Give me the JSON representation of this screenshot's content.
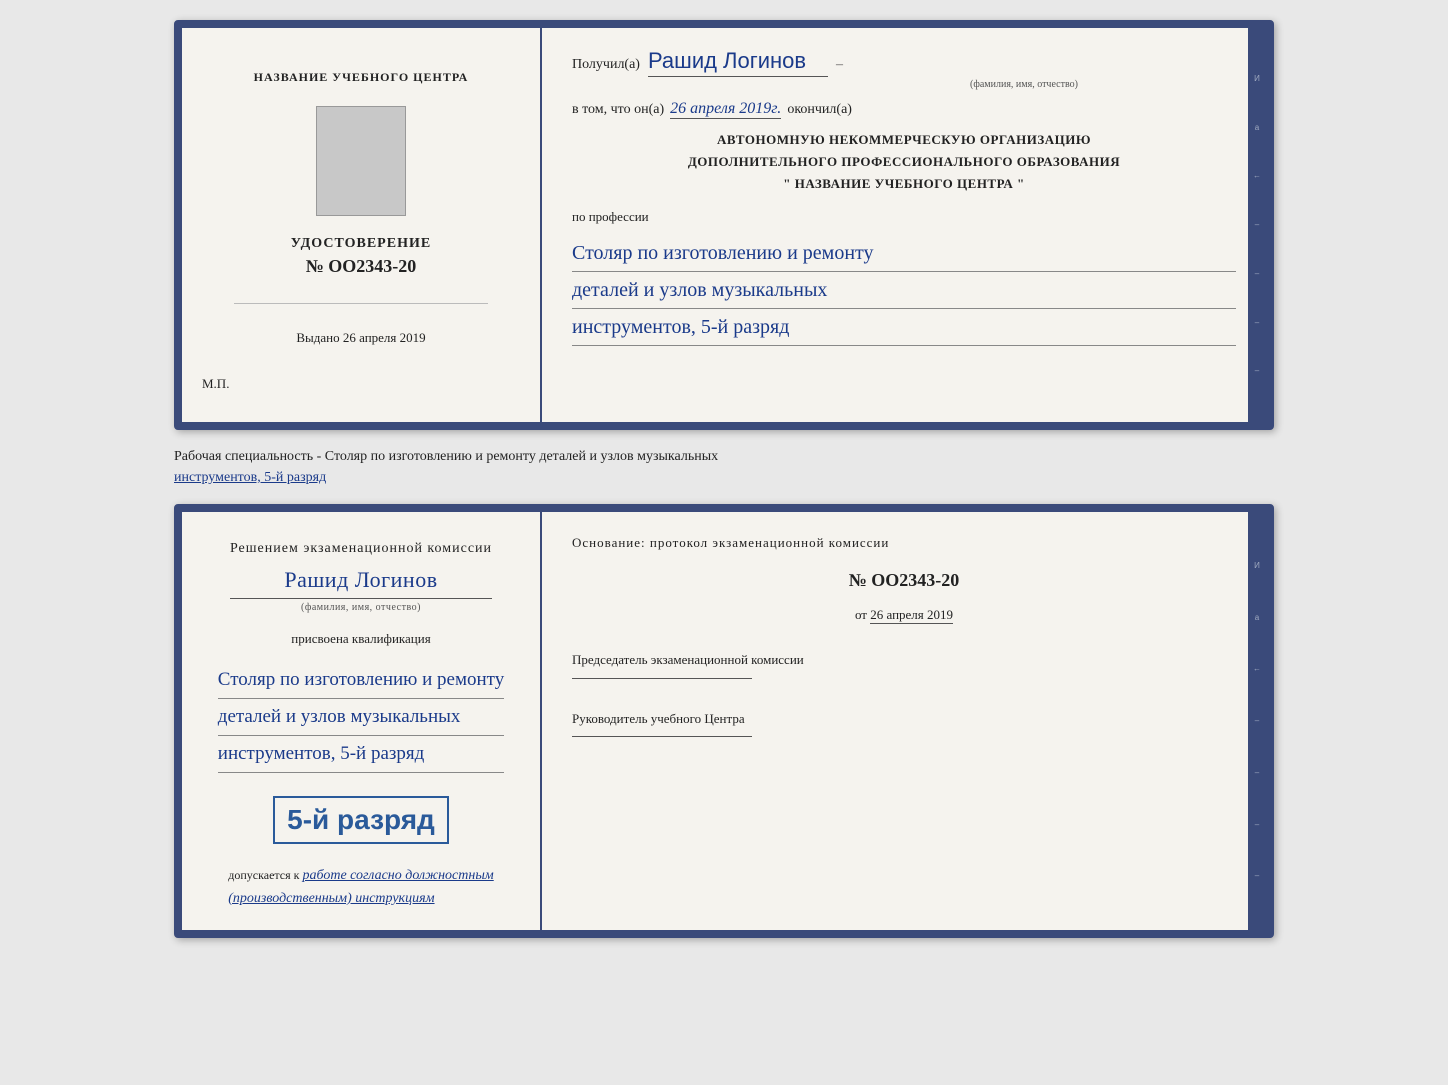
{
  "top_doc": {
    "left": {
      "center_name": "НАЗВАНИЕ УЧЕБНОГО ЦЕНТРА",
      "udostoverenie_label": "УДОСТОВЕРЕНИЕ",
      "number_prefix": "№",
      "number": "OO2343-20",
      "vydano_label": "Выдано",
      "vydano_date": "26 апреля 2019",
      "mp_label": "М.П."
    },
    "right": {
      "poluchil_label": "Получил(а)",
      "name_handwritten": "Рашид Логинов",
      "fio_hint": "(фамилия, имя, отчество)",
      "dash": "–",
      "vtom_label": "в том, что он(а)",
      "date_handwritten": "26 апреля 2019г.",
      "okonchil_label": "окончил(а)",
      "org_line1": "АВТОНОМНУЮ НЕКОММЕРЧЕСКУЮ ОРГАНИЗАЦИЮ",
      "org_line2": "ДОПОЛНИТЕЛЬНОГО ПРОФЕССИОНАЛЬНОГО ОБРАЗОВАНИЯ",
      "org_line3": "\"   НАЗВАНИЕ УЧЕБНОГО ЦЕНТРА   \"",
      "po_professii_label": "по профессии",
      "profession_line1": "Столяр по изготовлению и ремонту",
      "profession_line2": "деталей и узлов музыкальных",
      "profession_line3": "инструментов, 5-й разряд"
    }
  },
  "specialty_text": {
    "prefix": "Рабочая специальность - Столяр по изготовлению и ремонту деталей и узлов музыкальных",
    "underlined": "инструментов, 5-й разряд"
  },
  "bottom_doc": {
    "left": {
      "resheniem_label": "Решением экзаменационной комиссии",
      "name_handwritten": "Рашид Логинов",
      "fio_hint": "(фамилия, имя, отчество)",
      "prisvoena_label": "присвоена квалификация",
      "profession_line1": "Столяр по изготовлению и ремонту",
      "profession_line2": "деталей и узлов музыкальных",
      "profession_line3": "инструментов, 5-й разряд",
      "razryad_label": "5-й разряд",
      "dopuskaetsya_prefix": "допускается к",
      "dopuskaetsya_handwritten": "работе согласно должностным",
      "dopuskaetsya_handwritten2": "(производственным) инструкциям"
    },
    "right": {
      "osnovanie_label": "Основание: протокол экзаменационной комиссии",
      "number_prefix": "№",
      "number": "OO2343-20",
      "ot_prefix": "от",
      "ot_date": "26 апреля 2019",
      "predsedatel_label": "Председатель экзаменационной комиссии",
      "rukovoditel_label": "Руководитель учебного Центра"
    }
  },
  "side_chars": [
    "И",
    "а",
    "←",
    "–",
    "–",
    "–",
    "–"
  ],
  "side_chars2": [
    "И",
    "а",
    "←",
    "–",
    "–",
    "–",
    "–"
  ]
}
